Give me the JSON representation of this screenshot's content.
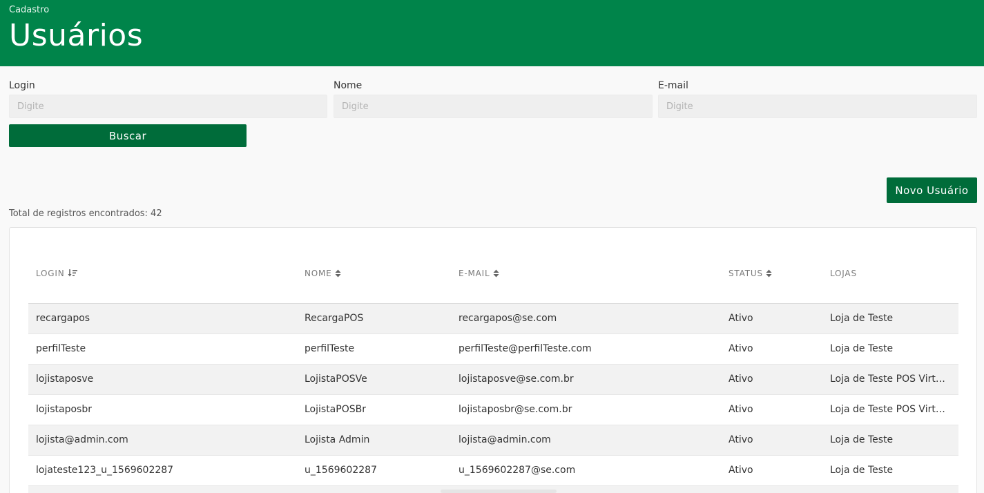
{
  "header": {
    "breadcrumb": "Cadastro",
    "title": "Usuários"
  },
  "filters": {
    "login": {
      "label": "Login",
      "placeholder": "Digite",
      "value": ""
    },
    "nome": {
      "label": "Nome",
      "placeholder": "Digite",
      "value": ""
    },
    "email": {
      "label": "E-mail",
      "placeholder": "Digite",
      "value": ""
    },
    "search_button": "Buscar"
  },
  "actions": {
    "new_user_button": "Novo Usuário"
  },
  "total_text": "Total de registros encontrados: 42",
  "table": {
    "columns": [
      {
        "label": "LOGIN",
        "sort": "sorted-desc"
      },
      {
        "label": "NOME",
        "sort": "sortable"
      },
      {
        "label": "E-MAIL",
        "sort": "sortable"
      },
      {
        "label": "STATUS",
        "sort": "sortable"
      },
      {
        "label": "LOJAS",
        "sort": "none"
      }
    ],
    "rows": [
      {
        "login": "recargapos",
        "nome": "RecargaPOS",
        "email": "recargapos@se.com",
        "status": "Ativo",
        "lojas": "Loja de Teste"
      },
      {
        "login": "perfilTeste",
        "nome": "perfilTeste",
        "email": "perfilTeste@perfilTeste.com",
        "status": "Ativo",
        "lojas": "Loja de Teste"
      },
      {
        "login": "lojistaposve",
        "nome": "LojistaPOSVe",
        "email": "lojistaposve@se.com.br",
        "status": "Ativo",
        "lojas": "Loja de Teste POS Virtual"
      },
      {
        "login": "lojistaposbr",
        "nome": "LojistaPOSBr",
        "email": "lojistaposbr@se.com.br",
        "status": "Ativo",
        "lojas": "Loja de Teste POS Virtual"
      },
      {
        "login": "lojista@admin.com",
        "nome": "Lojista Admin",
        "email": "lojista@admin.com",
        "status": "Ativo",
        "lojas": "Loja de Teste"
      },
      {
        "login": "lojateste123_u_1569602287",
        "nome": "u_1569602287",
        "email": "u_1569602287@se.com",
        "status": "Ativo",
        "lojas": "Loja de Teste"
      },
      {
        "login": "",
        "nome": "",
        "email": "",
        "status": "",
        "lojas": ""
      }
    ]
  },
  "colors": {
    "header_bg": "#00844a",
    "button_bg": "#006c3a",
    "row_alt_bg": "#f2f2f2"
  }
}
